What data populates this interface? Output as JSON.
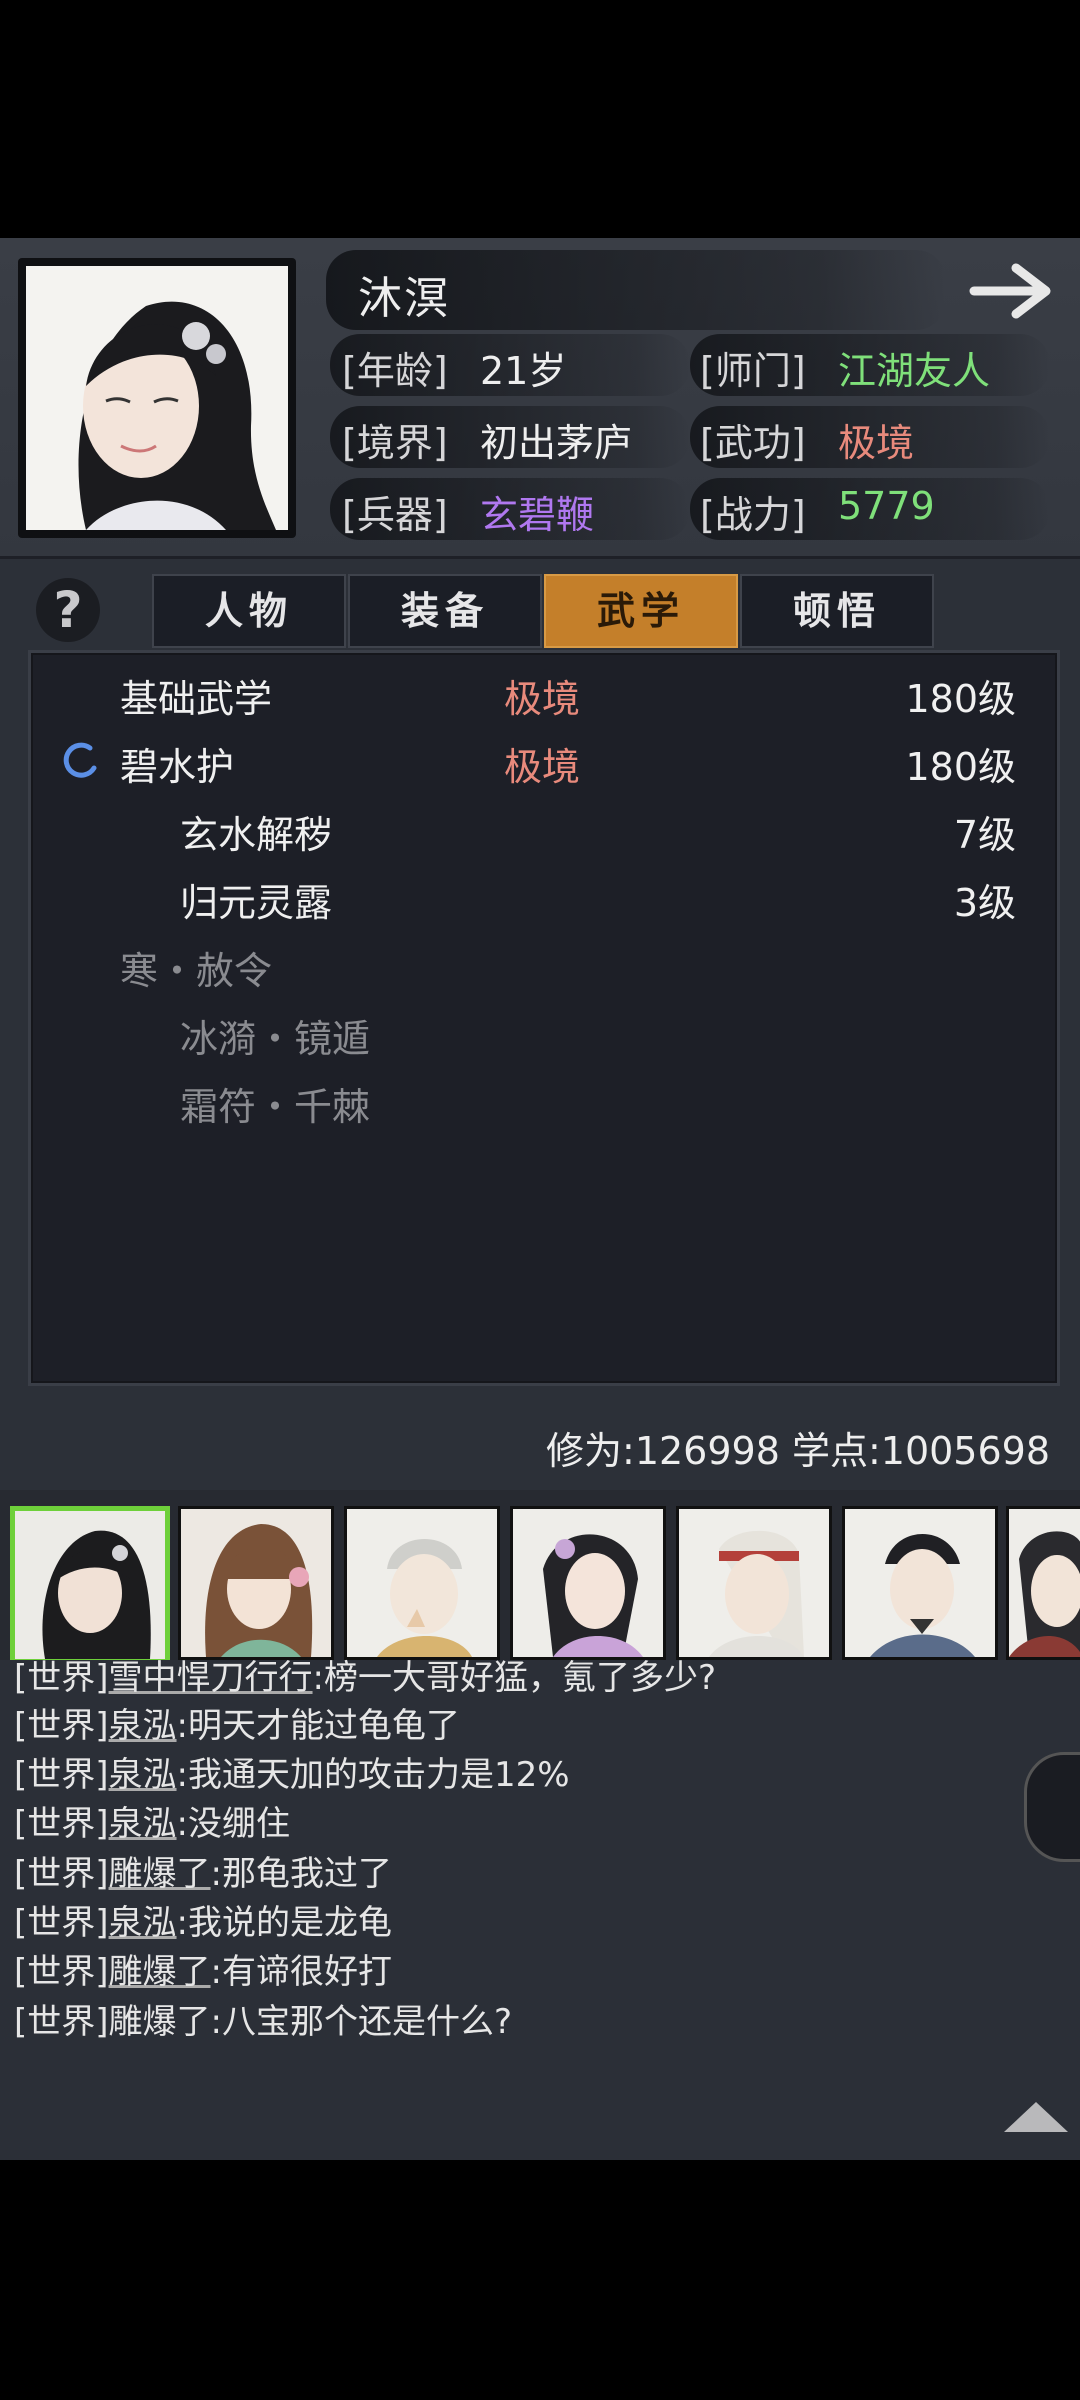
{
  "profile": {
    "name": "沐溟",
    "age_label": "[年龄]",
    "age": "21岁",
    "sect_label": "[师门]",
    "sect": "江湖友人",
    "realm_label": "[境界]",
    "realm": "初出茅庐",
    "martial_label": "[武功]",
    "martial": "极境",
    "weapon_label": "[兵器]",
    "weapon": "玄碧鞭",
    "power_label": "[战力]",
    "power": "5779"
  },
  "colors": {
    "green": "#7fe07a",
    "red": "#e88a7c",
    "purple": "#b078f0",
    "tab_active": "#c47f2a",
    "selected_border": "#6ed03a"
  },
  "tabs": [
    {
      "label": "人物",
      "active": false
    },
    {
      "label": "装备",
      "active": false
    },
    {
      "label": "武学",
      "active": true
    },
    {
      "label": "顿悟",
      "active": false
    }
  ],
  "skills": [
    {
      "name": "基础武学",
      "rank": "极境",
      "level": "180级"
    },
    {
      "name": "碧水护",
      "rank": "极境",
      "level": "180级"
    },
    {
      "name": "玄水解秽",
      "rank": "",
      "level": "7级"
    },
    {
      "name": "归元灵露",
      "rank": "",
      "level": "3级"
    },
    {
      "name": "寒・赦令",
      "rank": "",
      "level": ""
    },
    {
      "name": "冰漪・镜遁",
      "rank": "",
      "level": ""
    },
    {
      "name": "霜符・千棘",
      "rank": "",
      "level": ""
    }
  ],
  "points": "修为:126998  学点:1005698",
  "chat": [
    {
      "channel": "[世界]",
      "user": "雪中悍刀行行",
      "msg": ":榜一大哥好猛，氪了多少?"
    },
    {
      "channel": "[世界]",
      "user": "泉泓",
      "msg": ":明天才能过龟龟了"
    },
    {
      "channel": "[世界]",
      "user": "泉泓",
      "msg": ":我通天加的攻击力是12%"
    },
    {
      "channel": "[世界]",
      "user": "泉泓",
      "msg": ":没绷住"
    },
    {
      "channel": "[世界]",
      "user": "雕爆了",
      "msg": ":那龟我过了"
    },
    {
      "channel": "[世界]",
      "user": "泉泓",
      "msg": ":我说的是龙龟"
    },
    {
      "channel": "[世界]",
      "user": "雕爆了",
      "msg": ":有谛很好打"
    },
    {
      "channel": "[世界]",
      "user": "雕爆了",
      "msg": ":八宝那个还是什么?"
    }
  ]
}
